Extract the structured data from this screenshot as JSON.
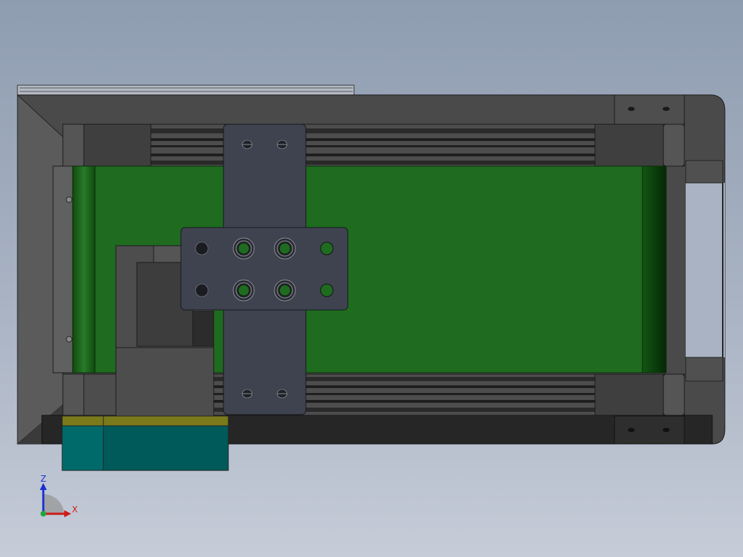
{
  "triad": {
    "z_label": "Z",
    "x_label": "X",
    "z_color": "#1a2fd0",
    "x_color": "#d01a1a",
    "y_color": "#1aa83a"
  },
  "model": {
    "belt_color": "#1f6b1f",
    "frame_color": "#4a4a4a",
    "plate_color": "#3f4350",
    "motor_color": "#006060",
    "motor_band_color": "#7a7a1a"
  }
}
